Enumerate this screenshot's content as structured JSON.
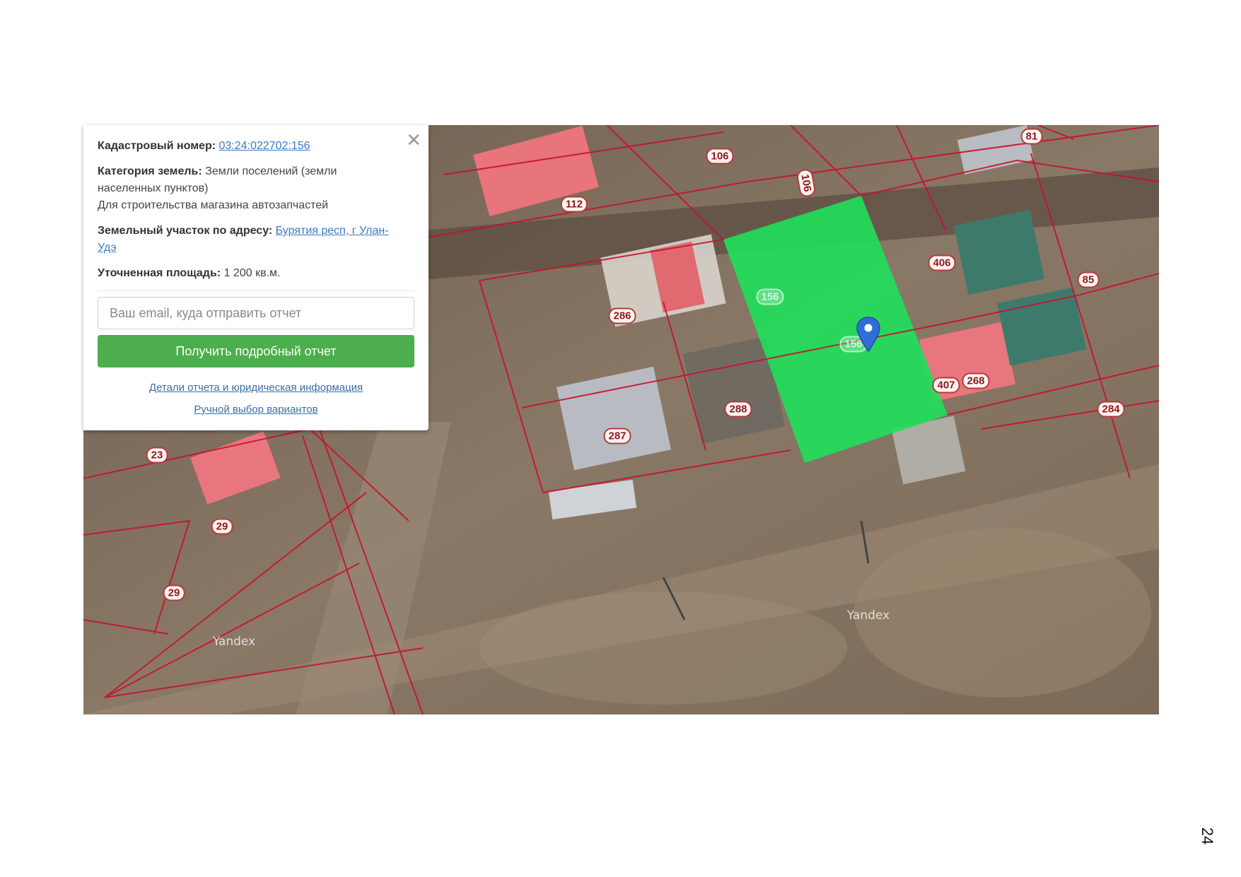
{
  "popup": {
    "cadastral_label": "Кадастровый номер:",
    "cadastral_value": "03:24:022702:156",
    "category_label": "Категория земель:",
    "category_value_1": "Земли поселений (земли",
    "category_value_2": "населенных пунктов)",
    "category_purpose": "Для строительства магазина автозапчастей",
    "address_label": "Земельный участок по адресу:",
    "address_value_1": "Бурятия респ, г Улан-",
    "address_value_2": "Удэ",
    "area_label": "Уточненная площадь:",
    "area_value": "1 200 кв.м.",
    "email_placeholder": "Ваш email, куда отправить отчет",
    "submit_label": "Получить подробный отчет",
    "details_link": "Детали отчета и юридическая информация",
    "manual_link": "Ручной выбор вариантов",
    "close_glyph": "✕"
  },
  "map": {
    "parcel_labels": [
      "106",
      "106",
      "112",
      "81",
      "156",
      "156",
      "406",
      "85",
      "286",
      "268",
      "407",
      "288",
      "284",
      "287",
      "23",
      "29",
      "29"
    ],
    "watermarks": [
      "Yandex",
      "Yandex"
    ],
    "highlight_color": "#1fe05a",
    "boundary_color": "#c8102e",
    "marker_icon": "map-pin-icon"
  },
  "page_number": "24"
}
